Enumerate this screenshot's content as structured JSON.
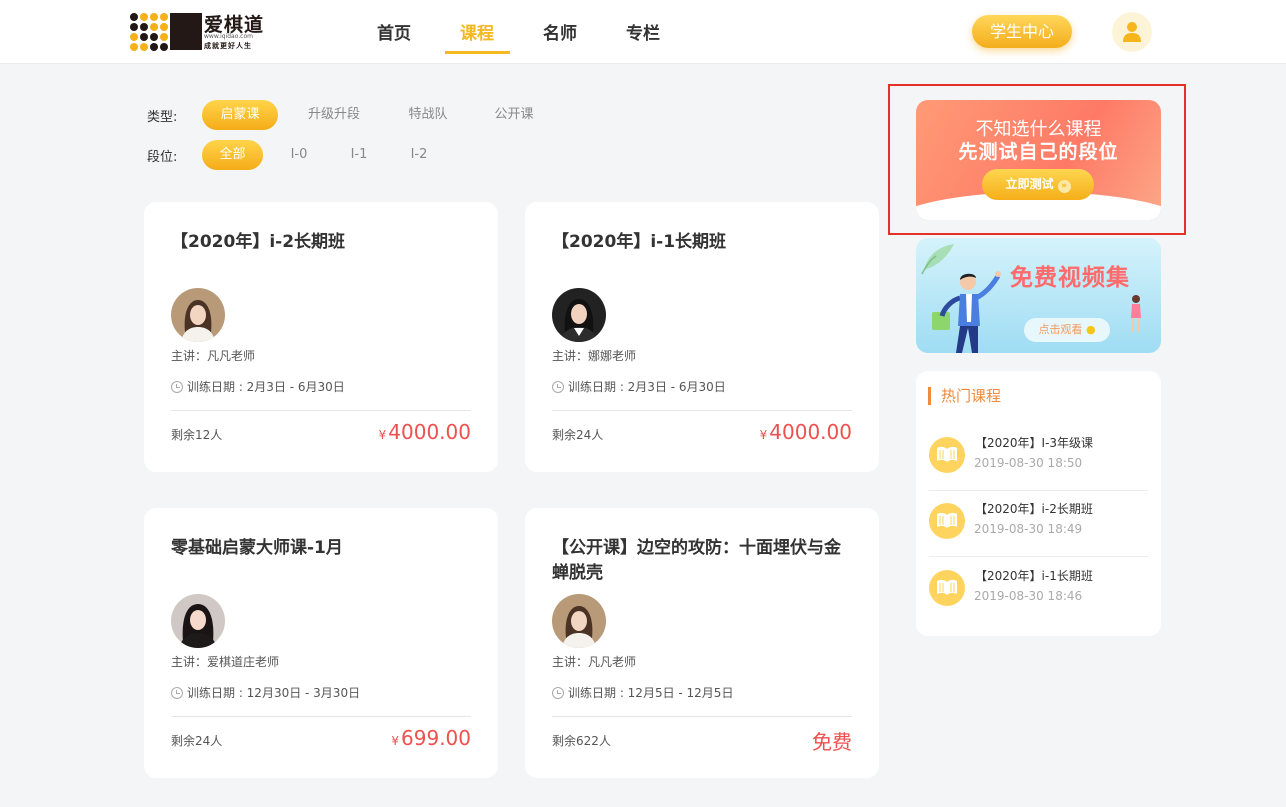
{
  "header": {
    "logo": {
      "name": "爱棋道",
      "url": "www.iqidao.com",
      "slogan": "成就更好人生"
    },
    "nav": [
      {
        "label": "首页",
        "active": false
      },
      {
        "label": "课程",
        "active": true
      },
      {
        "label": "名师",
        "active": false
      },
      {
        "label": "专栏",
        "active": false
      }
    ],
    "student_center": "学生中心",
    "user_icon": "user-icon"
  },
  "filters": {
    "type": {
      "label": "类型:",
      "options": [
        "启蒙课",
        "升级升段",
        "特战队",
        "公开课"
      ],
      "selected": "启蒙课"
    },
    "level": {
      "label": "段位:",
      "options": [
        "全部",
        "I-0",
        "I-1",
        "I-2"
      ],
      "selected": "全部"
    }
  },
  "courses": [
    {
      "title": "【2020年】i-2长期班",
      "teacher": "主讲：凡凡老师",
      "dates": "训练日期 : 2月3日 - 6月30日",
      "seats": "剩余12人",
      "currency": "¥",
      "price": "4000.00"
    },
    {
      "title": "【2020年】i-1长期班",
      "teacher": "主讲：娜娜老师",
      "dates": "训练日期 : 2月3日 - 6月30日",
      "seats": "剩余24人",
      "currency": "¥",
      "price": "4000.00"
    },
    {
      "title": "零基础启蒙大师课-1月",
      "teacher": "主讲：爱棋道庄老师",
      "dates": "训练日期 : 12月30日 - 3月30日",
      "seats": "剩余24人",
      "currency": "¥",
      "price": "699.00"
    },
    {
      "title": "【公开课】边空的攻防：十面埋伏与金蝉脱壳",
      "teacher": "主讲：凡凡老师",
      "dates": "训练日期 : 12月5日 - 12月5日",
      "seats": "剩余622人",
      "currency": "",
      "price": "免费"
    }
  ],
  "promo_test": {
    "line1": "不知选什么课程",
    "line2": "先测试自己的段位",
    "button": "立即测试"
  },
  "promo_video": {
    "title": "免费视频集",
    "button": "点击观看"
  },
  "hot": {
    "title": "热门课程",
    "items": [
      {
        "name": "【2020年】I-3年级课",
        "date": "2019-08-30 18:50"
      },
      {
        "name": "【2020年】i-2长期班",
        "date": "2019-08-30 18:49"
      },
      {
        "name": "【2020年】i-1长期班",
        "date": "2019-08-30 18:46"
      }
    ]
  },
  "colors": {
    "accent": "#f4b820",
    "price": "#ee4f4f",
    "hot_title": "#f08a3d",
    "highlight_frame": "#e53228"
  }
}
